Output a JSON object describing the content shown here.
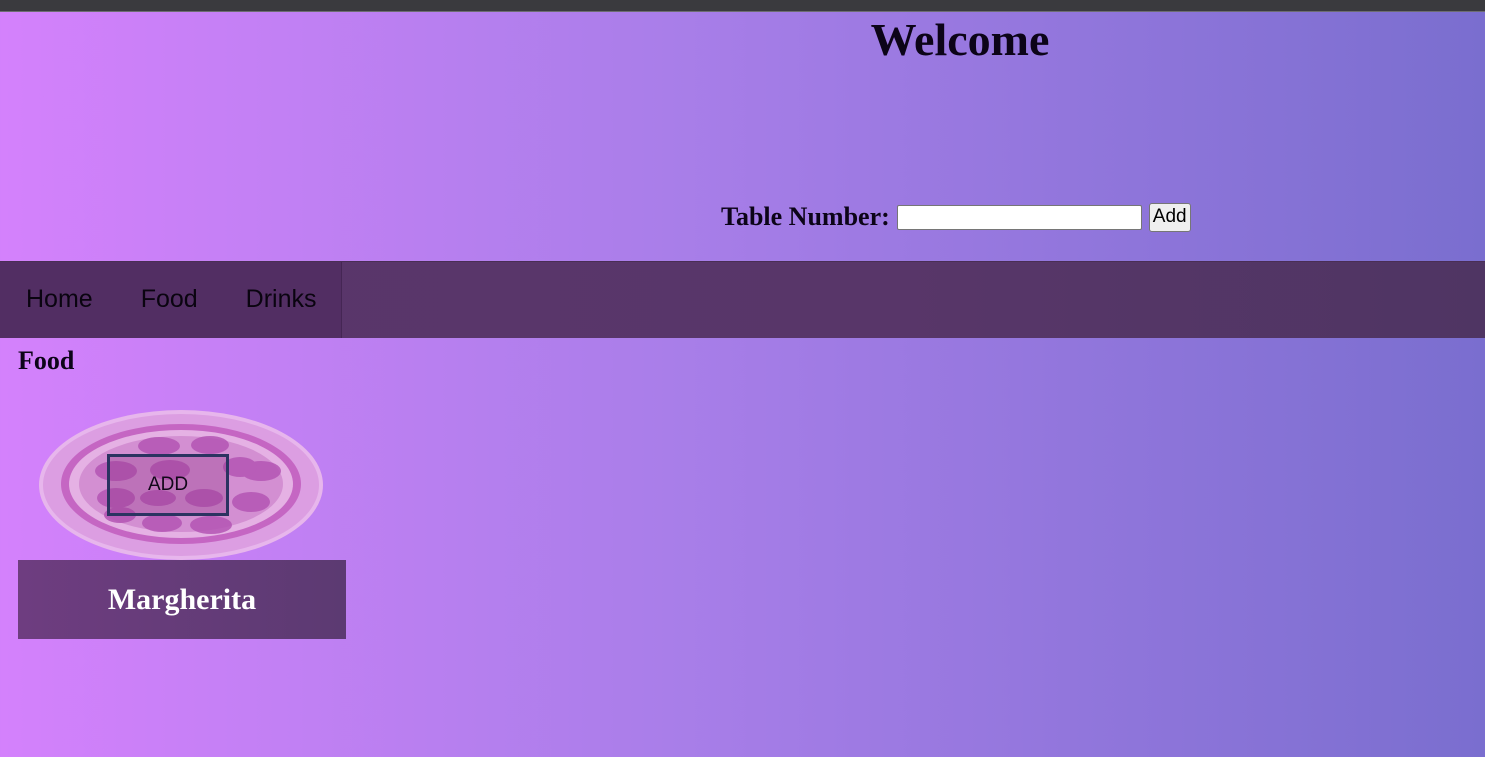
{
  "header": {
    "title": "Welcome",
    "table_label": "Table Number:",
    "table_input_value": "",
    "table_add_label": "Add"
  },
  "nav": {
    "items": [
      {
        "label": "Home"
      },
      {
        "label": "Food"
      },
      {
        "label": "Drinks"
      }
    ]
  },
  "main": {
    "section_title": "Food",
    "cards": [
      {
        "name": "Margherita",
        "add_label": "ADD",
        "image_icon": "pizza-icon"
      }
    ]
  },
  "colors": {
    "gradient_start": "#d481fc",
    "gradient_end": "#7a6ecf",
    "navbar": "#5a356b",
    "card_label_bg": "#6e3d80",
    "add_button_border": "#2b3361"
  }
}
